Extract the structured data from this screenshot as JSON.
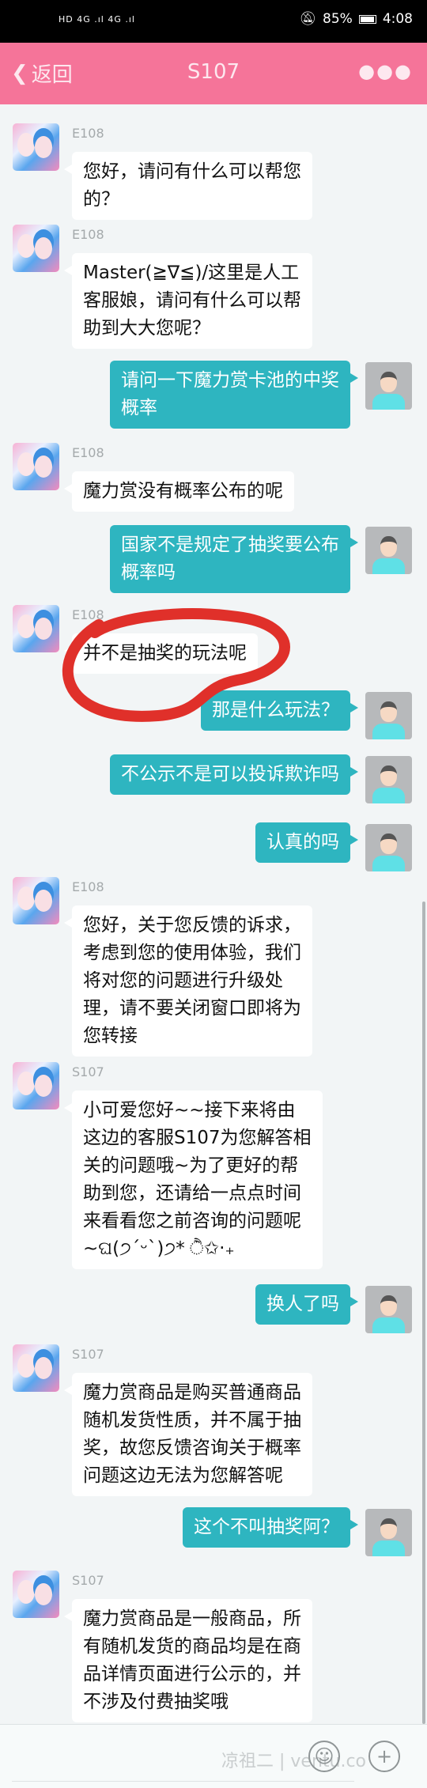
{
  "status_bar": {
    "left": "HD 4G .ıl 4G .ıl",
    "battery": "85%",
    "battery_level": 0.85,
    "time": "4:08"
  },
  "header": {
    "back_label": "返回",
    "title": "S107",
    "more_icon": "more-dots-icon"
  },
  "messages": [
    {
      "sender": "agent",
      "name": "E108",
      "text": "您好，请问有什么可以帮您\n的？"
    },
    {
      "sender": "agent",
      "name": "E108",
      "text": "Master(≧∇≦)/这里是人工\n客服娘，请问有什么可以帮\n助到大大您呢？"
    },
    {
      "sender": "user",
      "text": "请问一下魔力赏卡池的中奖\n概率"
    },
    {
      "sender": "agent",
      "name": "E108",
      "text": "魔力赏没有概率公布的呢"
    },
    {
      "sender": "user",
      "text": "国家不是规定了抽奖要公布\n概率吗"
    },
    {
      "sender": "agent",
      "name": "E108",
      "text": "并不是抽奖的玩法呢",
      "highlighted": true
    },
    {
      "sender": "user",
      "text": "那是什么玩法？"
    },
    {
      "sender": "user",
      "text": "不公示不是可以投诉欺诈吗"
    },
    {
      "sender": "user",
      "text": "认真的吗"
    },
    {
      "sender": "agent",
      "name": "E108",
      "text": "您好，关于您反馈的诉求，\n考虑到您的使用体验，我们\n将对您的问题进行升级处\n理，请不要关闭窗口即将为\n您转接"
    },
    {
      "sender": "agent",
      "name": "S107",
      "text": "小可爱您好~~接下来将由\n这边的客服S107为您解答相\n关的问题哦~为了更好的帮\n助到您，还请给一点点时间\n来看看您之前咨询的问题呢\n~ଘ(੭ˊᵕˋ)੭* ੈ✩‧₊"
    },
    {
      "sender": "user",
      "text": "换人了吗"
    },
    {
      "sender": "agent",
      "name": "S107",
      "text": "魔力赏商品是购买普通商品\n随机发货性质，并不属于抽\n奖，故您反馈咨询关于概率\n问题这边无法为您解答呢"
    },
    {
      "sender": "user",
      "text": "这个不叫抽奖阿？"
    },
    {
      "sender": "agent",
      "name": "S107",
      "text": "魔力赏商品是一般商品，所\n有随机发货的商品均是在商\n品详情页面进行公示的，并\n不涉及付费抽奖哦"
    }
  ],
  "input_bar": {
    "watermark": "凉祖二 | ventu.co",
    "emoji_icon": "smiley-icon",
    "plus_icon": "plus-icon"
  },
  "colors": {
    "header": "#f57499",
    "user_bubble": "#2eb5c0",
    "agent_bubble": "#ffffff",
    "annotation": "#e0302a"
  }
}
